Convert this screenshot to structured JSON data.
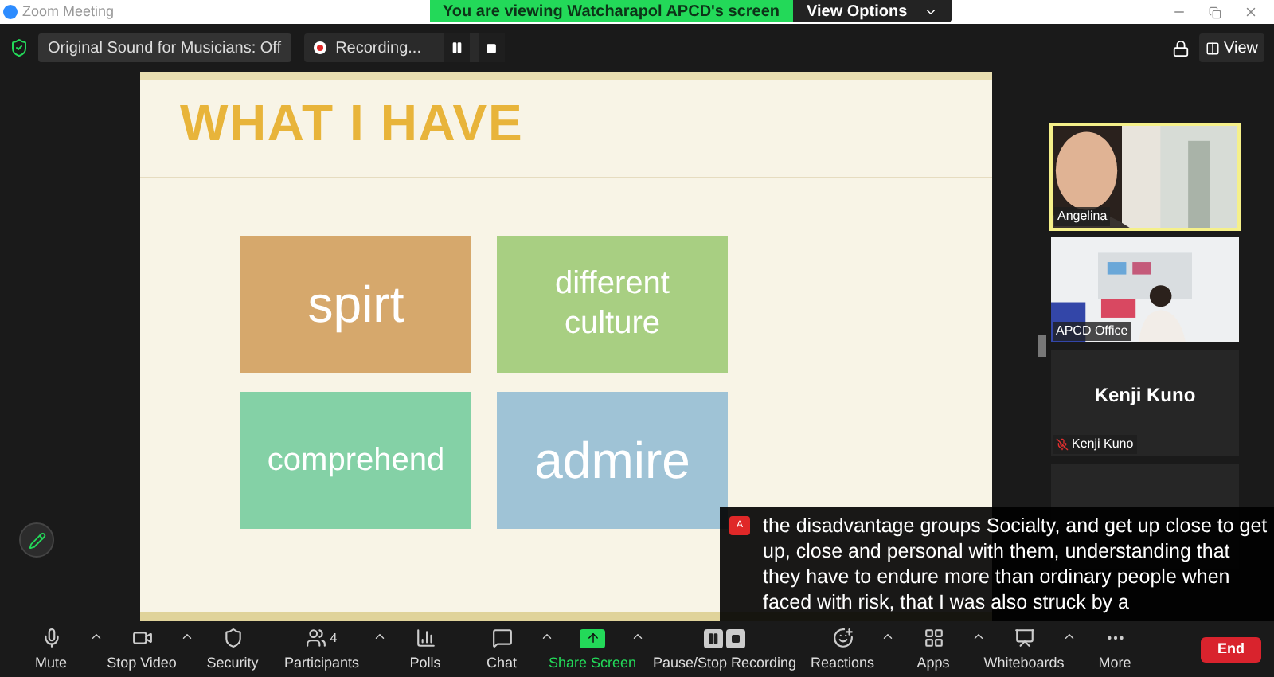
{
  "window": {
    "title": "Zoom Meeting"
  },
  "banner": {
    "text": "You are viewing Watcharapol APCD's screen",
    "button": "View Options"
  },
  "top_bar": {
    "sound_button": "Original Sound for Musicians: Off",
    "recording": "Recording...",
    "view_button": "View"
  },
  "slide": {
    "title": "WHAT I HAVE",
    "boxes": [
      {
        "text": "spirt",
        "color": "#d6a86c"
      },
      {
        "text": "different culture",
        "color": "#a8cf82"
      },
      {
        "text": "comprehend",
        "color": "#84d1a6"
      },
      {
        "text": "admire",
        "color": "#9fc3d6"
      }
    ]
  },
  "participants": [
    {
      "name": "Angelina",
      "kind": "video",
      "speaking": true
    },
    {
      "name": "APCD Office",
      "kind": "video",
      "speaking": false
    },
    {
      "name": "Kenji Kuno",
      "display_name": "Kenji Kuno",
      "kind": "avatar",
      "speaking": false,
      "muted": true
    },
    {
      "kind": "empty",
      "speaking": false
    }
  ],
  "caption": {
    "badge": "A",
    "text": "the disadvantage groups Socialty, and get up close to get up, close and personal with them, understanding that they have to endure more than ordinary people when faced with risk, that I was also struck by a"
  },
  "toolbar": [
    {
      "label": "Mute",
      "menu": true,
      "active": false
    },
    {
      "label": "Stop Video",
      "menu": true,
      "active": false
    },
    {
      "label": "Security",
      "menu": false,
      "active": false
    },
    {
      "label": "Participants",
      "count": "4",
      "menu": true,
      "active": false
    },
    {
      "label": "Polls",
      "menu": false,
      "active": false
    },
    {
      "label": "Chat",
      "menu": true,
      "active": false
    },
    {
      "label": "Share Screen",
      "menu": true,
      "active": true
    },
    {
      "label": "Pause/Stop Recording",
      "menu": false,
      "active": false
    },
    {
      "label": "Reactions",
      "menu": true,
      "active": false
    },
    {
      "label": "Apps",
      "menu": true,
      "active": false
    },
    {
      "label": "Whiteboards",
      "menu": true,
      "active": false
    },
    {
      "label": "More",
      "menu": false,
      "active": false
    }
  ],
  "end_button": "End"
}
